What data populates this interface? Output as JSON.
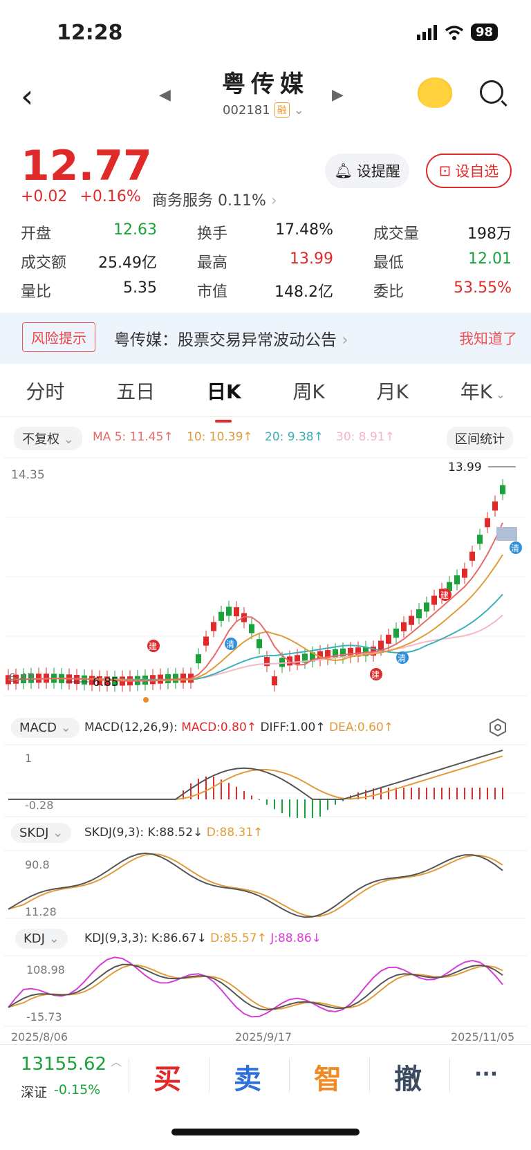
{
  "status": {
    "time": "12:28",
    "battery": "98"
  },
  "header": {
    "name": "粤传媒",
    "code": "002181",
    "badge": "融"
  },
  "quote": {
    "price": "12.77",
    "change": "+0.02",
    "change_pct": "+0.16%",
    "sector": "商务服务 0.11%",
    "remind_label": "设提醒",
    "fav_label": "设自选"
  },
  "stats": [
    [
      {
        "l": "开盘",
        "v": "12.63",
        "c": "green"
      },
      {
        "l": "换手",
        "v": "17.48%",
        "c": ""
      },
      {
        "l": "成交量",
        "v": "198万",
        "c": ""
      }
    ],
    [
      {
        "l": "成交额",
        "v": "25.49亿",
        "c": ""
      },
      {
        "l": "最高",
        "v": "13.99",
        "c": "red"
      },
      {
        "l": "最低",
        "v": "12.01",
        "c": "green"
      }
    ],
    [
      {
        "l": "量比",
        "v": "5.35",
        "c": ""
      },
      {
        "l": "市值",
        "v": "148.2亿",
        "c": ""
      },
      {
        "l": "委比",
        "v": "53.55%",
        "c": "red"
      }
    ]
  ],
  "notice": {
    "tag": "风险提示",
    "text": "粤传媒：股票交易异常波动公告",
    "ok": "我知道了"
  },
  "tabs": [
    "分时",
    "五日",
    "日K",
    "周K",
    "月K",
    "年K"
  ],
  "kchart": {
    "adjust": "不复权",
    "ma5": "MA 5: 11.45↑",
    "ma10": "10: 10.39↑",
    "ma20": "20: 9.38↑",
    "ma30": "30: 8.91↑",
    "range_stat": "区间统计",
    "ytop": "14.35",
    "ybottom": "6.47",
    "high": "13.99",
    "low": "6.85",
    "markers": {
      "build": "建",
      "clear": "清"
    }
  },
  "macd": {
    "name": "MACD",
    "params": "MACD(12,26,9):",
    "macd": "MACD:0.80↑",
    "diff": "DIFF:1.00↑",
    "dea": "DEA:0.60↑",
    "ytop": "1",
    "ybottom": "-0.28"
  },
  "skdj": {
    "name": "SKDJ",
    "params": "SKDJ(9,3):",
    "k": "K:88.52↓",
    "d": "D:88.31↑",
    "ytop": "90.8",
    "ybottom": "11.28"
  },
  "kdj": {
    "name": "KDJ",
    "params": "KDJ(9,3,3):",
    "k": "K:86.67↓",
    "d": "D:85.57↑",
    "j": "J:88.86↓",
    "ytop": "108.98",
    "ybottom": "-15.73"
  },
  "dates": [
    "2025/8/06",
    "2025/9/17",
    "2025/11/05"
  ],
  "index": {
    "value": "13155.62",
    "name": "深证",
    "change": "-0.15%"
  },
  "actions": {
    "buy": "买",
    "sell": "卖",
    "smart": "智",
    "cancel": "撤",
    "more": "···"
  },
  "colors": {
    "up": "#e02a2a",
    "down": "#19a33a",
    "ma5": "#e86a6a",
    "ma10": "#e09c3a",
    "ma20": "#3ab0b8",
    "ma30": "#f5b7c3"
  }
}
